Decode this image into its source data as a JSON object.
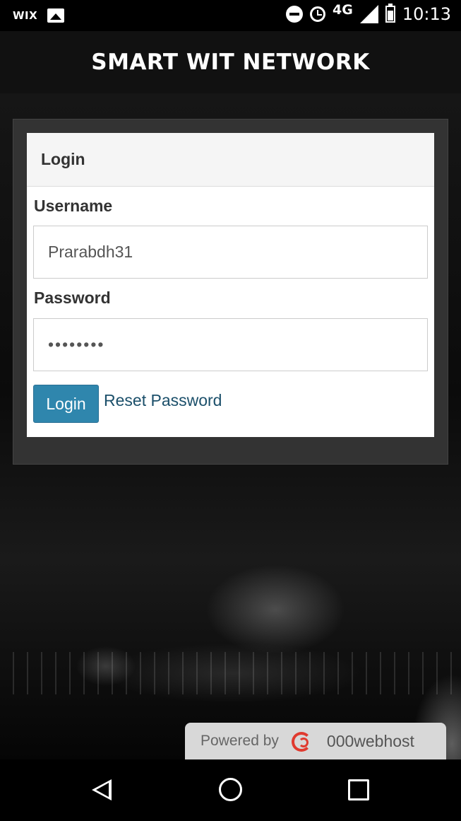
{
  "status_bar": {
    "left_label": "WIX",
    "network": "4G",
    "time": "10:13"
  },
  "app_bar": {
    "title": "SMART WIT NETWORK"
  },
  "login_card": {
    "header": "Login",
    "username_label": "Username",
    "username_value": "Prarabdh31",
    "password_label": "Password",
    "password_value": "••••••••",
    "login_button": "Login",
    "reset_link": "Reset Password"
  },
  "powered_badge": {
    "text": "Powered by",
    "brand": "000webhost"
  },
  "colors": {
    "login_button": "#2f86ad",
    "link": "#1b4f6a",
    "brand_accent": "#e03a2f"
  }
}
